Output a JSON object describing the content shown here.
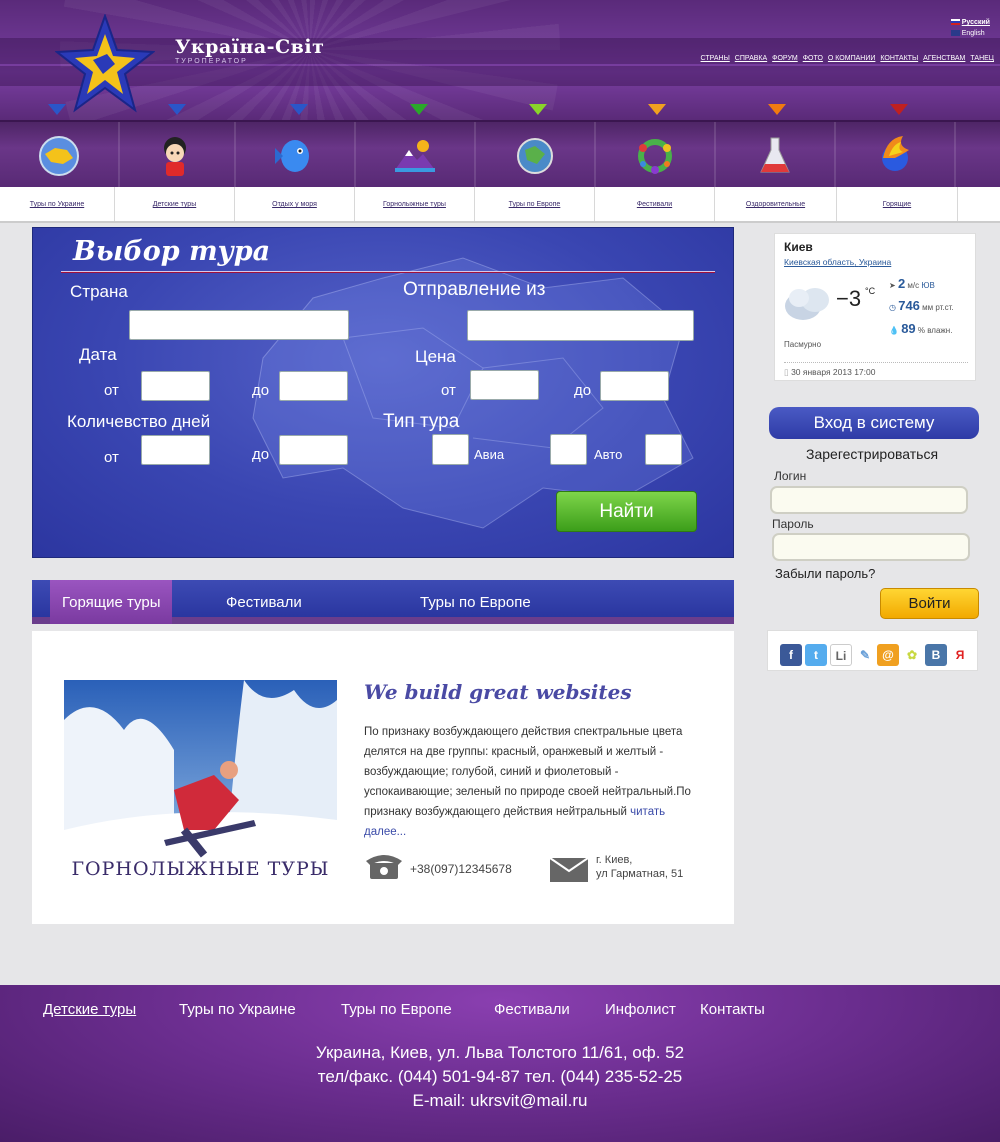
{
  "header": {
    "logo_title": "Україна-Світ",
    "logo_subtitle": "ТУРОПЕРАТОР",
    "languages": [
      "Русский",
      "English"
    ],
    "top_nav": [
      "СТРАНЫ",
      "СПРАВКА",
      "ФОРУМ",
      "ФОТО",
      "О КОМПАНИИ",
      "КОНТАКТЫ",
      "АГЕНСТВАМ",
      "ТАНЕЦ"
    ],
    "arrow_colors": [
      "#2a56c8",
      "#2a56c8",
      "#2a56c8",
      "#2aa82a",
      "#8ad42a",
      "#f0a020",
      "#f07a10",
      "#c02020"
    ]
  },
  "categories": [
    {
      "label": "Туры по Украине",
      "icon": "ukraine-globe-icon"
    },
    {
      "label": "Детские туры",
      "icon": "child-icon"
    },
    {
      "label": "Отдых у моря",
      "icon": "fish-icon"
    },
    {
      "label": "Горнолыжные туры",
      "icon": "mountain-icon"
    },
    {
      "label": "Туры по Европе",
      "icon": "europe-globe-icon"
    },
    {
      "label": "Фестивали",
      "icon": "festival-wreath-icon"
    },
    {
      "label": "Оздоровительные",
      "icon": "flask-icon"
    },
    {
      "label": "Горящие",
      "icon": "fire-globe-icon"
    }
  ],
  "tour_form": {
    "title": "Выбор тура",
    "country_label": "Страна",
    "departure_label": "Отправление из",
    "date_label": "Дата",
    "price_label": "Цена",
    "days_label": "Количевство дней",
    "tour_type_label": "Тип тура",
    "from": "от",
    "to": "до",
    "avia": "Авиа",
    "auto": "Авто",
    "search_button": "Найти"
  },
  "tabs": [
    "Горящие туры",
    "Фестивали",
    "Туры по Европе"
  ],
  "article": {
    "image_caption": "ГОРНОЛЫЖНЫЕ ТУРЫ",
    "title": "We build great websites",
    "text": "По признаку возбуждающего действия спектральные цвета делятся на две группы: красный, оранжевый и желтый - возбуждающие; голубой, синий и фиолетовый - успокаивающие; зеленый по природе своей нейтральный.По признаку возбуждающего действия нейтральный ",
    "read_more": "читать далее...",
    "phone": "+38(097)12345678",
    "address_line1": "г. Киев,",
    "address_line2": "ул Гарматная, 51"
  },
  "weather": {
    "city": "Киев",
    "region": "Киевская область",
    "country": "Украина",
    "temperature": "−3",
    "temp_unit": "°C",
    "wind_speed": "2",
    "wind_unit": "м/с",
    "wind_dir": "ЮВ",
    "pressure": "746",
    "pressure_unit": "мм рт.ст.",
    "humidity": "89",
    "humidity_unit": "% влажн.",
    "condition": "Пасмурно",
    "date": "30 января 2013 17:00"
  },
  "login": {
    "header": "Вход в систему",
    "register": "Зарегестрироваться",
    "login_label": "Логин",
    "password_label": "Пароль",
    "forgot": "Забыли пароль?",
    "button": "Войти"
  },
  "social": [
    {
      "name": "facebook-icon",
      "glyph": "f",
      "color": "#3b5998"
    },
    {
      "name": "twitter-icon",
      "glyph": "t",
      "color": "#55acee"
    },
    {
      "name": "linkedin-icon",
      "glyph": "Li",
      "color": "#9a9a9a"
    },
    {
      "name": "livejournal-icon",
      "glyph": "✎",
      "color": "#6aa0d8"
    },
    {
      "name": "mailru-icon",
      "glyph": "@",
      "color": "#f0a020"
    },
    {
      "name": "yaru-icon",
      "glyph": "✿",
      "color": "#c8d840"
    },
    {
      "name": "vkontakte-icon",
      "glyph": "В",
      "color": "#4a76a8"
    },
    {
      "name": "yandex-icon",
      "glyph": "Я",
      "color": "#e02020"
    }
  ],
  "footer": {
    "nav": [
      "Детские туры",
      "Туры по Украине",
      "Туры по Европе",
      "Фестивали",
      "Инфолист",
      "Контакты"
    ],
    "address": "Украина, Киев, ул. Льва Толстого 11/61, оф. 52",
    "phones": "тел/факс. (044) 501-94-87 тел. (044) 235-52-25",
    "email": "E-mail: ukrsvit@mail.ru"
  }
}
